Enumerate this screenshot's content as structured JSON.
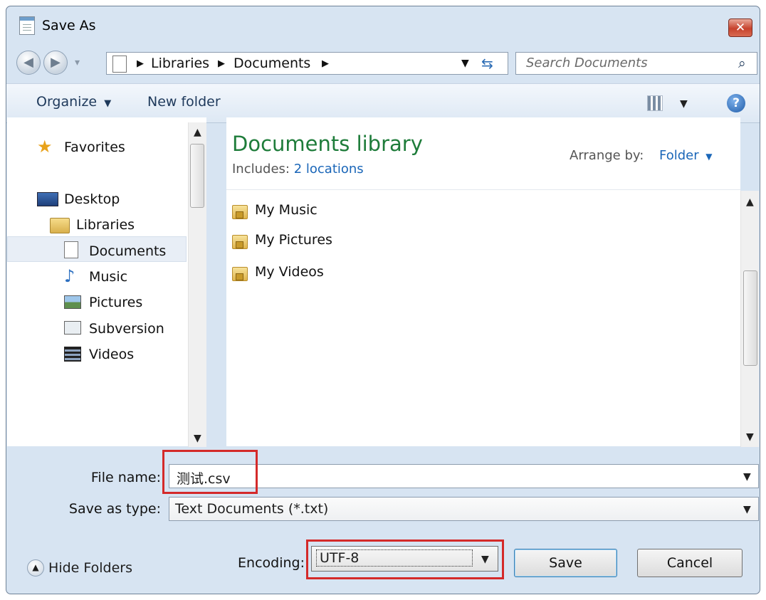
{
  "window": {
    "title": "Save As",
    "close_glyph": "✕"
  },
  "nav": {
    "back_glyph": "◀",
    "forward_glyph": "▶",
    "address": {
      "segments": [
        "Libraries",
        "Documents"
      ]
    },
    "search_placeholder": "Search Documents"
  },
  "toolbar": {
    "organize": "Organize",
    "new_folder": "New folder"
  },
  "sidebar": {
    "favorites": "Favorites",
    "desktop": "Desktop",
    "libraries": "Libraries",
    "items": [
      {
        "label": "Documents"
      },
      {
        "label": "Music"
      },
      {
        "label": "Pictures"
      },
      {
        "label": "Subversion"
      },
      {
        "label": "Videos"
      }
    ]
  },
  "library": {
    "title": "Documents library",
    "includes_label": "Includes:",
    "includes_link": "2 locations",
    "arrange_label": "Arrange by:",
    "arrange_value": "Folder",
    "folders": [
      "My Music",
      "My Pictures",
      "My Videos"
    ]
  },
  "form": {
    "file_name_label": "File name:",
    "file_name_value": "测试.csv",
    "save_type_label": "Save as type:",
    "save_type_value": "Text Documents (*.txt)",
    "encoding_label": "Encoding:",
    "encoding_value": "UTF-8",
    "hide_folders": "Hide Folders",
    "save": "Save",
    "cancel": "Cancel"
  },
  "colors": {
    "highlight_box": "#d42a2a",
    "library_title": "#1e7c3a",
    "link": "#1a66b8"
  }
}
